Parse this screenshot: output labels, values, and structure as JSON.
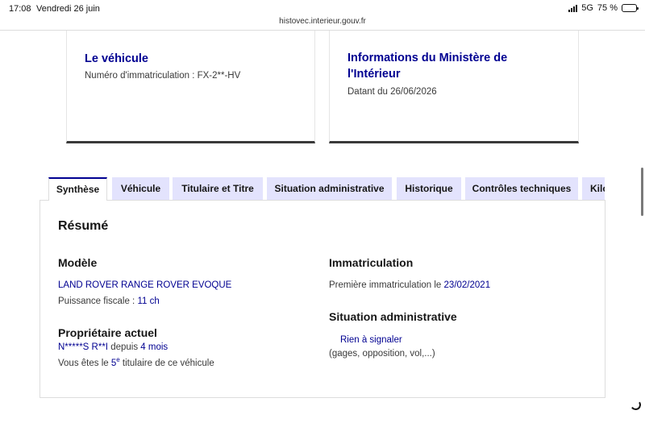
{
  "status": {
    "time": "17:08",
    "date": "Vendredi 26 juin",
    "network": "5G",
    "battery": "75 %",
    "battery_level": 0.75
  },
  "browser": {
    "url": "histovec.interieur.gouv.fr"
  },
  "cards": {
    "vehicle": {
      "title": "Le véhicule",
      "plate_label": "Numéro d'immatriculation :",
      "plate_value": "FX-2**-HV"
    },
    "ministry": {
      "title_line1": "Informations du Ministère de",
      "title_line2": "l'Intérieur",
      "date_label": "Datant du",
      "date_value": "26/06/2026"
    }
  },
  "tabs": [
    {
      "label": "Synthèse",
      "active": true
    },
    {
      "label": "Véhicule",
      "active": false
    },
    {
      "label": "Titulaire et Titre",
      "active": false
    },
    {
      "label": "Situation administrative",
      "active": false
    },
    {
      "label": "Historique",
      "active": false
    },
    {
      "label": "Contrôles techniques",
      "active": false
    },
    {
      "label": "Kilo",
      "active": false
    }
  ],
  "summary": {
    "title": "Résumé",
    "model": {
      "heading": "Modèle",
      "name": "LAND ROVER RANGE ROVER EVOQUE",
      "power_label": "Puissance fiscale :",
      "power_value": "11 ch"
    },
    "owner": {
      "heading": "Propriétaire actuel",
      "name": "N*****S R**I",
      "since_label": "depuis",
      "since_value": "4 mois",
      "rank_prefix": "Vous êtes le",
      "rank_number": "5",
      "rank_sup": "e",
      "rank_suffix": "titulaire de ce véhicule"
    },
    "registration": {
      "heading": "Immatriculation",
      "first_label": "Première immatriculation le",
      "first_date": "23/02/2021"
    },
    "admin": {
      "heading": "Situation administrative",
      "status": "Rien à signaler",
      "detail": "(gages, opposition, vol,...)"
    }
  },
  "colors": {
    "primary_blue": "#000091",
    "tab_background": "#e3e3fd",
    "text": "#161616",
    "muted_text": "#3a3a3a"
  }
}
